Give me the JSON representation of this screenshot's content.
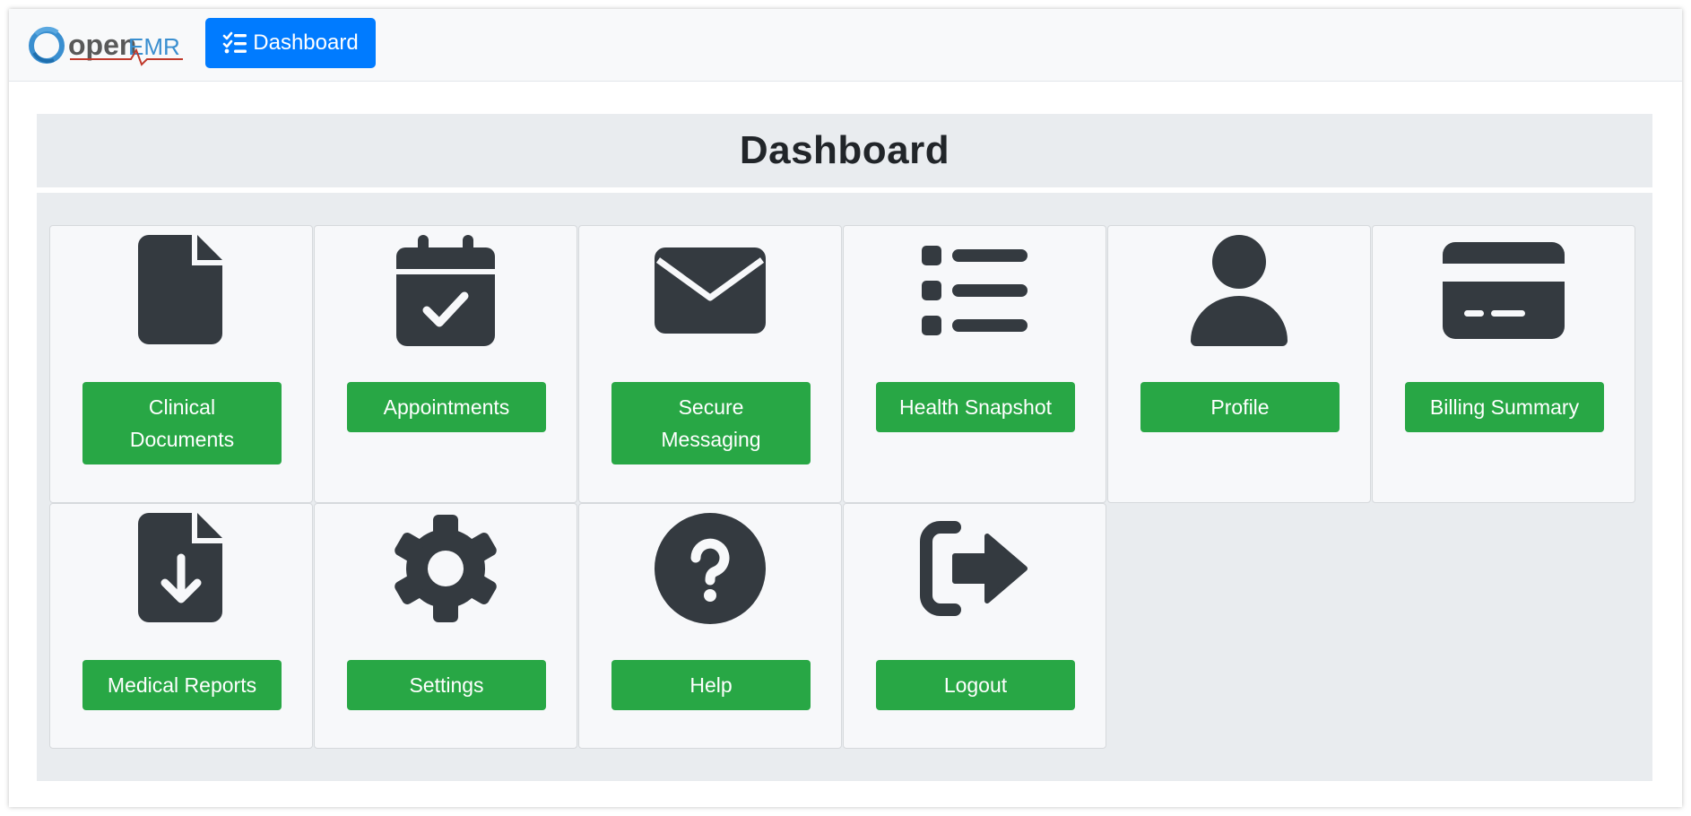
{
  "navbar": {
    "logo_text": "openEMR",
    "dashboard_button": "Dashboard"
  },
  "page": {
    "title": "Dashboard"
  },
  "cards": [
    {
      "label": "Clinical Documents",
      "icon": "file-icon"
    },
    {
      "label": "Appointments",
      "icon": "calendar-check-icon"
    },
    {
      "label": "Secure Messaging",
      "icon": "envelope-icon"
    },
    {
      "label": "Health Snapshot",
      "icon": "list-icon"
    },
    {
      "label": "Profile",
      "icon": "user-icon"
    },
    {
      "label": "Billing Summary",
      "icon": "credit-card-icon"
    },
    {
      "label": "Medical Reports",
      "icon": "file-download-icon"
    },
    {
      "label": "Settings",
      "icon": "gear-icon"
    },
    {
      "label": "Help",
      "icon": "question-circle-icon"
    },
    {
      "label": "Logout",
      "icon": "sign-out-icon"
    }
  ],
  "colors": {
    "primary": "#007bff",
    "success": "#28a745",
    "icon": "#343a40",
    "panel": "#e9ecef"
  }
}
